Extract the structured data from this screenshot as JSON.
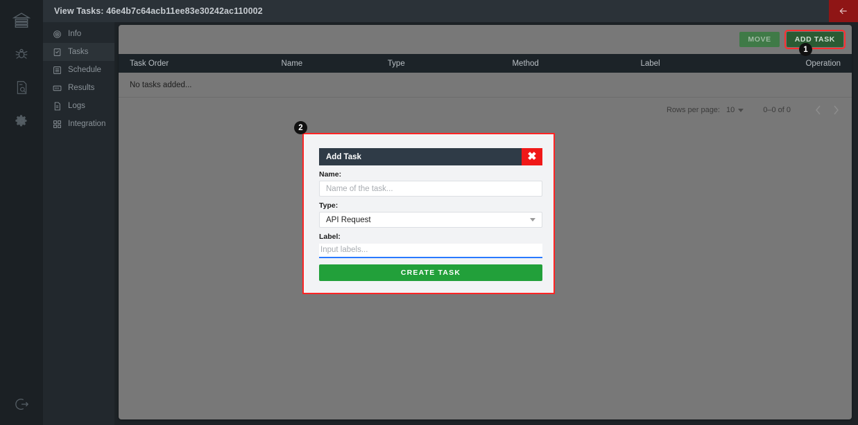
{
  "window": {
    "title": "View Tasks: 46e4b7c64acb11ee83e30242ac110002",
    "back_icon": "arrow-left-icon"
  },
  "rail": {
    "items": [
      {
        "icon": "bank-logo-icon",
        "label": ""
      },
      {
        "icon": "bug-icon",
        "label": ""
      },
      {
        "icon": "document-search-icon",
        "label": ""
      },
      {
        "icon": "gear-icon",
        "label": ""
      }
    ],
    "bottom": {
      "icon": "logout-icon",
      "label": ""
    }
  },
  "sidebar": {
    "items": [
      {
        "label": "Info",
        "icon": "fingerprint-icon",
        "selected": false
      },
      {
        "label": "Tasks",
        "icon": "clipboard-check-icon",
        "selected": true
      },
      {
        "label": "Schedule",
        "icon": "schedule-icon",
        "selected": false
      },
      {
        "label": "Results",
        "icon": "results-icon",
        "selected": false
      },
      {
        "label": "Logs",
        "icon": "file-icon",
        "selected": false
      },
      {
        "label": "Integration",
        "icon": "grid-icon",
        "selected": false
      }
    ]
  },
  "toolbar": {
    "move_label": "MOVE",
    "add_task_label": "ADD TASK"
  },
  "table": {
    "columns": [
      "Task Order",
      "Name",
      "Type",
      "Method",
      "Label",
      "Operation"
    ],
    "empty_text": "No tasks added...",
    "rows": []
  },
  "pagination": {
    "rows_per_page_label": "Rows per page:",
    "rows_per_page_value": "10",
    "range_text": "0–0 of 0",
    "prev_icon": "chevron-left-icon",
    "next_icon": "chevron-right-icon"
  },
  "modal": {
    "title": "Add Task",
    "close_icon": "close-icon",
    "close_glyph": "✖",
    "name_label": "Name:",
    "name_value": "",
    "name_placeholder": "Name of the task...",
    "type_label": "Type:",
    "type_value": "API Request",
    "label_label": "Label:",
    "label_value": "",
    "label_placeholder": "Input labels...",
    "submit_label": "CREATE TASK"
  },
  "annotations": {
    "badge_1": "1",
    "badge_2": "2"
  },
  "colors": {
    "accent_green": "#22a03a",
    "highlight_red": "#ff2424",
    "close_red": "#f01818",
    "header_dark": "#2f3b47",
    "panel_gray": "#787878",
    "focus_blue": "#2979ff"
  }
}
